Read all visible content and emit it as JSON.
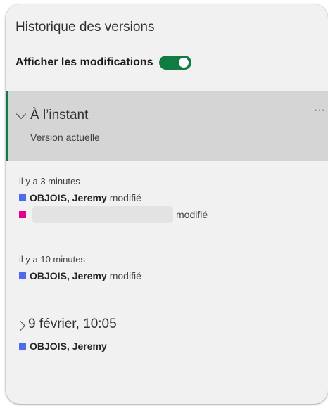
{
  "panel": {
    "title": "Historique des versions",
    "toggle_label": "Afficher les modifications",
    "toggle_on": true
  },
  "current": {
    "title": "À l’instant",
    "subtitle": "Version actuelle",
    "more_icon": "···"
  },
  "groups": [
    {
      "timestamp": "il y a 3 minutes",
      "entries": [
        {
          "name": "OBJOIS, Jeremy",
          "action": "modifié",
          "color": "#4f6bed"
        },
        {
          "name": "",
          "action": "modifié",
          "color": "#e3008c",
          "redacted": true
        }
      ]
    },
    {
      "timestamp": "il y a 10 minutes",
      "entries": [
        {
          "name": "OBJOIS, Jeremy",
          "action": "modifié",
          "color": "#4f6bed"
        }
      ]
    }
  ],
  "older": {
    "title": "9 février, 10:05",
    "entry": {
      "name": "OBJOIS, Jeremy",
      "color": "#4f6bed"
    }
  },
  "colors": {
    "accent": "#107c41",
    "panel_bg": "#f1f1f1",
    "selected_bg": "#d4d5d4"
  }
}
